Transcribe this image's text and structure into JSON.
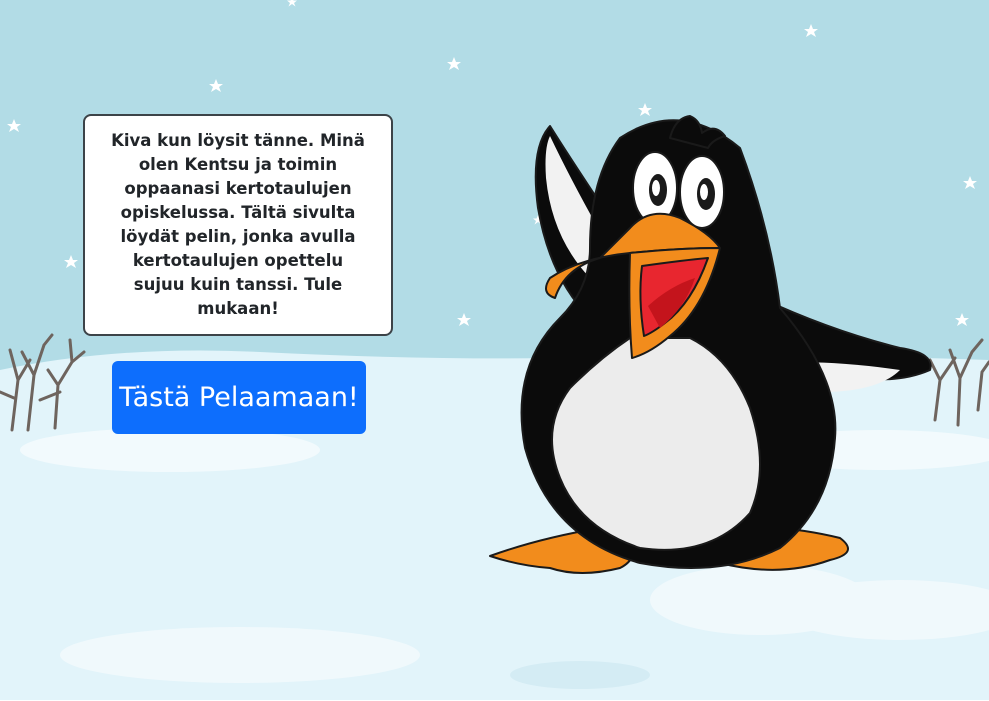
{
  "speech_bubble": {
    "text": "Kiva kun löysit tänne. Minä olen Kentsu ja toimin oppaanasi kertotaulujen opiskelussa. Tältä sivulta löydät pelin, jonka avulla kertotaulujen opettelu sujuu kuin tanssi. Tule mukaan!"
  },
  "play_button": {
    "label": "Tästä Pelaamaan!"
  },
  "colors": {
    "sky": "#b2dce6",
    "snow": "#e2f4fa",
    "button": "#0d6efd",
    "penguin_beak": "#f28c1c",
    "penguin_mouth": "#e8262f"
  }
}
